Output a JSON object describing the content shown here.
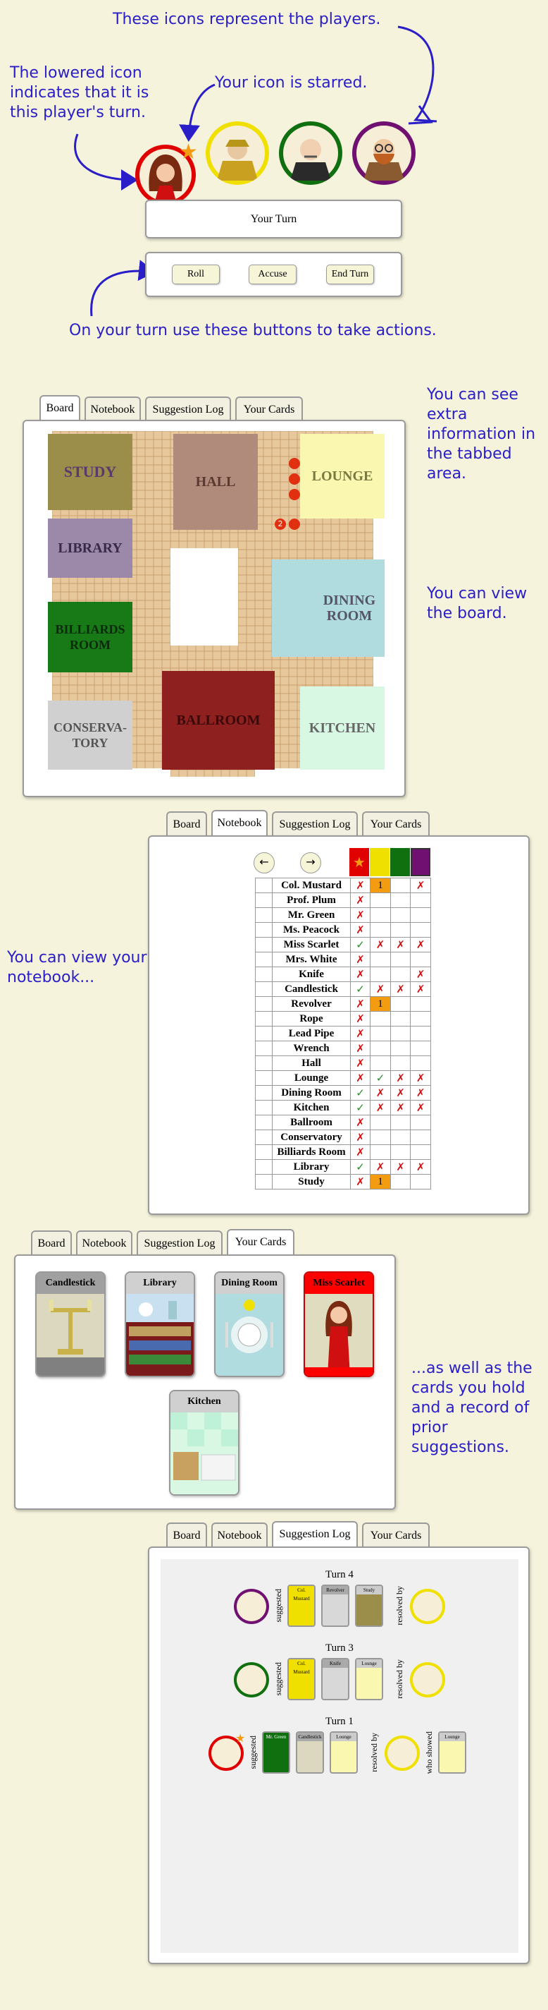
{
  "annotations": {
    "players_icons": "These icons represent the players.",
    "lowered_icon": "The lowered icon indicates that it is this player's turn.",
    "starred": "Your icon is starred.",
    "buttons": "On your turn use these buttons to take actions.",
    "tabbed": "You can see extra information in the tabbed area.",
    "board": "You can view the board.",
    "notebook": "You can view your notebook...",
    "cards": "...as well as the cards you hold and a record of prior suggestions."
  },
  "turn_status": "Your Turn",
  "actions": {
    "roll": "Roll",
    "accuse": "Accuse",
    "end_turn": "End Turn"
  },
  "tabs": {
    "board": "Board",
    "notebook": "Notebook",
    "log": "Suggestion Log",
    "cards": "Your Cards"
  },
  "colors": {
    "scarlet": "#e00000",
    "mustard": "#f0e000",
    "green": "#107010",
    "plum": "#701070",
    "highlight": "#f39c12"
  },
  "rooms": {
    "study": "STUDY",
    "hall": "HALL",
    "lounge": "LOUNGE",
    "library": "LIBRARY",
    "dining": "DINING ROOM",
    "billiards": "BILLIARDS ROOM",
    "conservatory": "CONSERVA-TORY",
    "ballroom": "BALLROOM",
    "kitchen": "KITCHEN"
  },
  "board_roll": "2",
  "notebook": {
    "nav_prev": "←",
    "nav_next": "→",
    "star": "★",
    "rows": [
      {
        "name": "Col. Mustard",
        "c": [
          "✗",
          "1",
          "",
          "✗"
        ]
      },
      {
        "name": "Prof. Plum",
        "c": [
          "✗",
          "",
          "",
          ""
        ]
      },
      {
        "name": "Mr. Green",
        "c": [
          "✗",
          "",
          "",
          ""
        ]
      },
      {
        "name": "Ms. Peacock",
        "c": [
          "✗",
          "",
          "",
          ""
        ]
      },
      {
        "name": "Miss Scarlet",
        "c": [
          "✓",
          "✗",
          "✗",
          "✗"
        ]
      },
      {
        "name": "Mrs. White",
        "c": [
          "✗",
          "",
          "",
          ""
        ]
      },
      {
        "name": "Knife",
        "c": [
          "✗",
          "",
          "",
          "✗"
        ]
      },
      {
        "name": "Candlestick",
        "c": [
          "✓",
          "✗",
          "✗",
          "✗"
        ]
      },
      {
        "name": "Revolver",
        "c": [
          "✗",
          "1",
          "",
          ""
        ]
      },
      {
        "name": "Rope",
        "c": [
          "✗",
          "",
          "",
          ""
        ]
      },
      {
        "name": "Lead Pipe",
        "c": [
          "✗",
          "",
          "",
          ""
        ]
      },
      {
        "name": "Wrench",
        "c": [
          "✗",
          "",
          "",
          ""
        ]
      },
      {
        "name": "Hall",
        "c": [
          "✗",
          "",
          "",
          ""
        ]
      },
      {
        "name": "Lounge",
        "c": [
          "✗",
          "✓",
          "✗",
          "✗"
        ]
      },
      {
        "name": "Dining Room",
        "c": [
          "✓",
          "✗",
          "✗",
          "✗"
        ]
      },
      {
        "name": "Kitchen",
        "c": [
          "✓",
          "✗",
          "✗",
          "✗"
        ]
      },
      {
        "name": "Ballroom",
        "c": [
          "✗",
          "",
          "",
          ""
        ]
      },
      {
        "name": "Conservatory",
        "c": [
          "✗",
          "",
          "",
          ""
        ]
      },
      {
        "name": "Billiards Room",
        "c": [
          "✗",
          "",
          "",
          ""
        ]
      },
      {
        "name": "Library",
        "c": [
          "✓",
          "✗",
          "✗",
          "✗"
        ]
      },
      {
        "name": "Study",
        "c": [
          "✗",
          "1",
          "",
          ""
        ]
      }
    ]
  },
  "your_cards": [
    "Candlestick",
    "Library",
    "Dining Room",
    "Miss Scarlet",
    "Kitchen"
  ],
  "log": {
    "turn4": "Turn 4",
    "turn3": "Turn 3",
    "turn1": "Turn 1",
    "suggested": "suggested",
    "resolved_by": "resolved by",
    "who_showed": "who showed",
    "t4_cards": [
      "Col. Mustard",
      "Revolver",
      "Study"
    ],
    "t3_cards": [
      "Col. Mustard",
      "Knife",
      "Lounge"
    ],
    "t1_cards": [
      "Mr. Green",
      "Candlestick",
      "Lounge"
    ],
    "t1_shown": "Lounge"
  }
}
